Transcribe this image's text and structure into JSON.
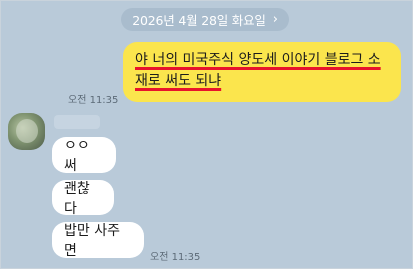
{
  "date_header": {
    "text": "2026년 4월 28일 화요일",
    "chevron": "›"
  },
  "sent_message": {
    "line1": "야 너의 미국주식 양도세 이야기 블로그 소",
    "line2": "재로 써도 되냐",
    "time": "오전 11:35"
  },
  "received": {
    "messages": [
      "ㅇㅇ 써",
      "괜찮다",
      "밥만 사주면"
    ],
    "time": "오전 11:35"
  },
  "colors": {
    "background": "#b9cad9",
    "sent_bubble": "#fbe54d",
    "received_bubble": "#ffffff",
    "underline": "#e8132b"
  }
}
